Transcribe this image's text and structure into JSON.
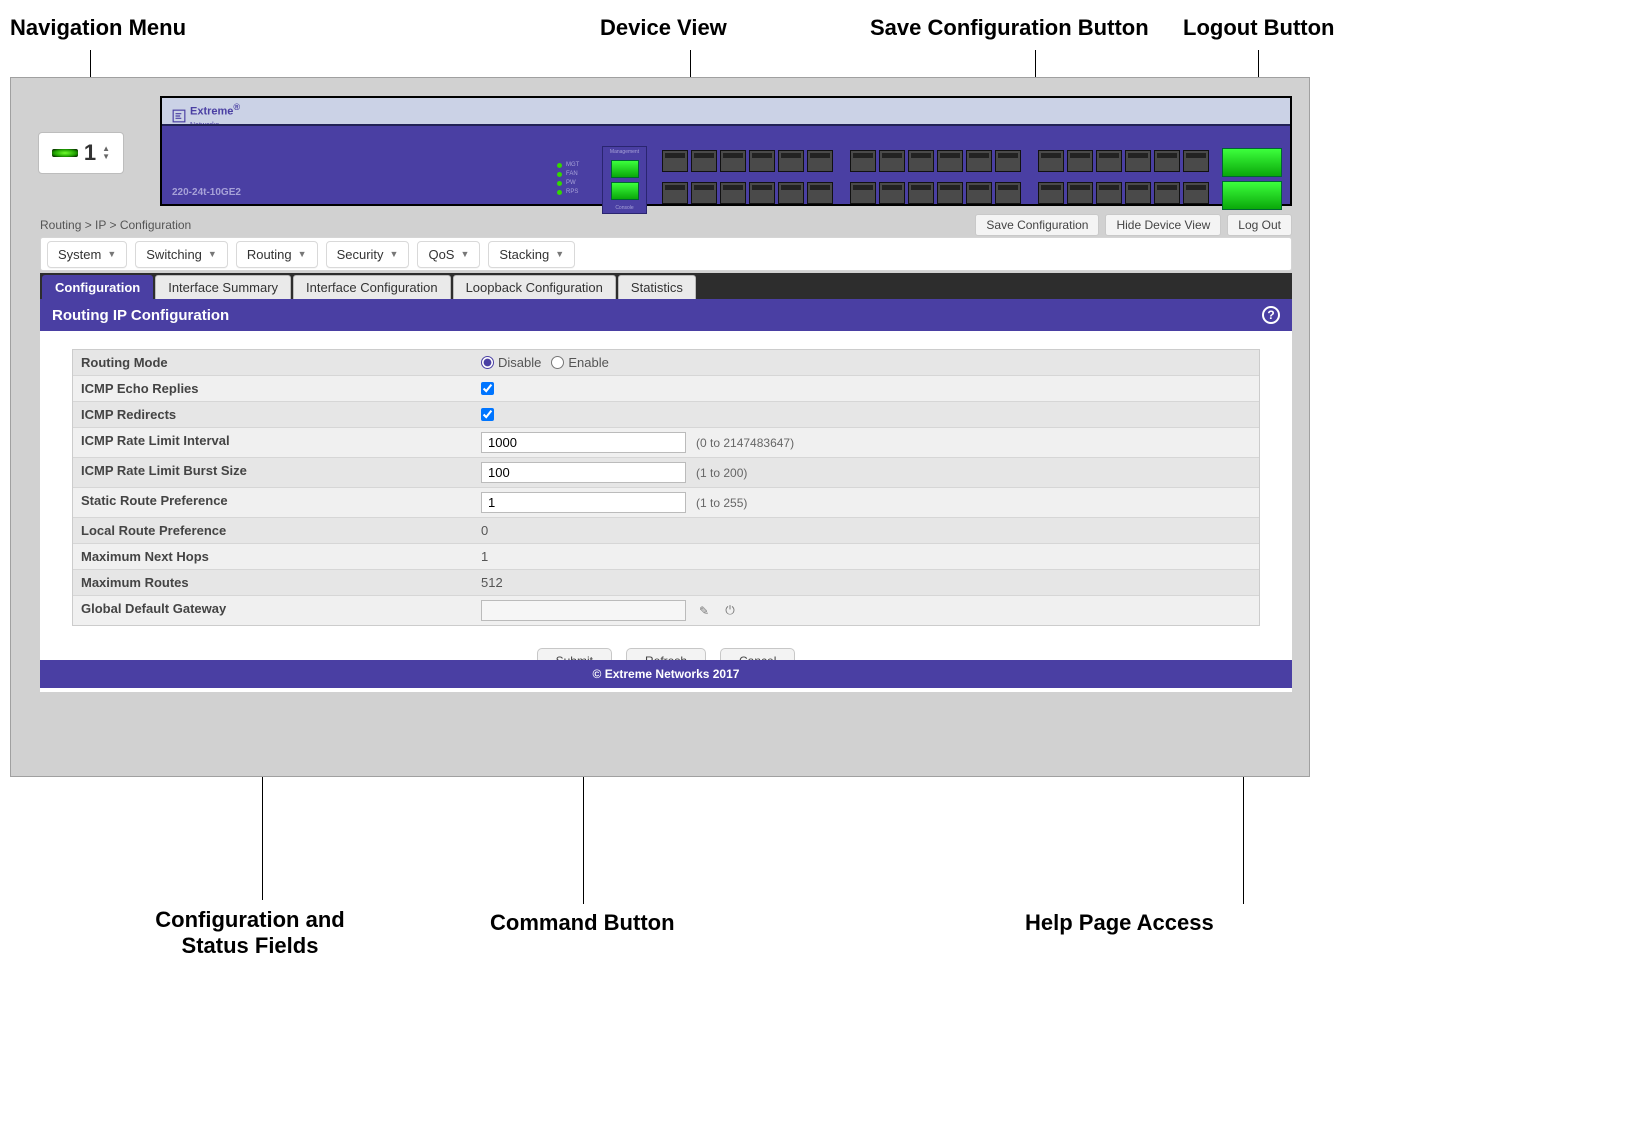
{
  "annotations": {
    "navMenu": "Navigation Menu",
    "deviceView": "Device View",
    "saveConfig": "Save Configuration Button",
    "logout": "Logout Button",
    "configFields": "Configuration and\nStatus Fields",
    "commandButton": "Command Button",
    "helpAccess": "Help Page Access"
  },
  "device": {
    "brand": "Extreme",
    "brand_sub": "Networks",
    "model": "220-24t-10GE2",
    "leds": [
      "MGT",
      "FAN",
      "PW",
      "RPS"
    ],
    "mgmt_labels": [
      "Management",
      "Console"
    ]
  },
  "stack": {
    "number": "1"
  },
  "breadcrumb": "Routing > IP > Configuration",
  "actions": {
    "save": "Save Configuration",
    "hideDevice": "Hide Device View",
    "logout": "Log Out"
  },
  "nav": [
    "System",
    "Switching",
    "Routing",
    "Security",
    "QoS",
    "Stacking"
  ],
  "tabs": [
    "Configuration",
    "Interface Summary",
    "Interface Configuration",
    "Loopback Configuration",
    "Statistics"
  ],
  "activeTab": 0,
  "pageTitle": "Routing IP Configuration",
  "form": {
    "routingMode": {
      "label": "Routing Mode",
      "opt1": "Disable",
      "opt2": "Enable",
      "value": "Disable"
    },
    "icmpEcho": {
      "label": "ICMP Echo Replies",
      "checked": true
    },
    "icmpRedir": {
      "label": "ICMP Redirects",
      "checked": true
    },
    "rateInterval": {
      "label": "ICMP Rate Limit Interval",
      "value": "1000",
      "hint": "(0 to 2147483647)"
    },
    "rateBurst": {
      "label": "ICMP Rate Limit Burst Size",
      "value": "100",
      "hint": "(1 to 200)"
    },
    "staticPref": {
      "label": "Static Route Preference",
      "value": "1",
      "hint": "(1 to 255)"
    },
    "localPref": {
      "label": "Local Route Preference",
      "value": "0"
    },
    "maxNextHops": {
      "label": "Maximum Next Hops",
      "value": "1"
    },
    "maxRoutes": {
      "label": "Maximum Routes",
      "value": "512"
    },
    "defaultGw": {
      "label": "Global Default Gateway",
      "value": ""
    }
  },
  "cmd": {
    "submit": "Submit",
    "refresh": "Refresh",
    "cancel": "Cancel"
  },
  "footer": "© Extreme Networks 2017"
}
